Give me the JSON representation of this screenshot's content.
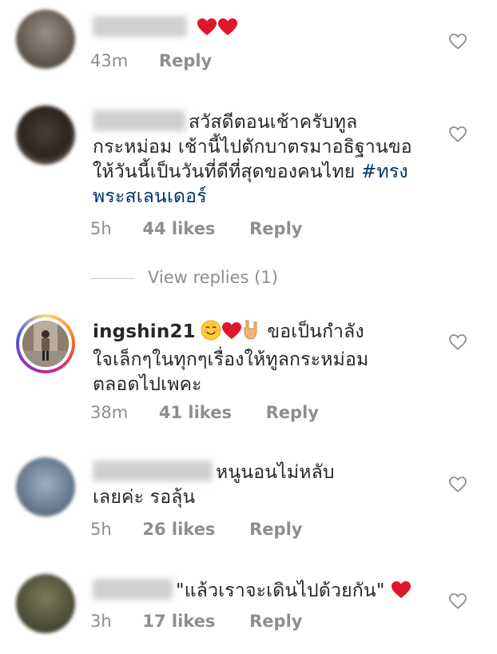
{
  "comments": [
    {
      "username": "",
      "text": "",
      "emojis": [
        "heart",
        "heart"
      ],
      "time": "43m",
      "likes": "",
      "reply": "Reply"
    },
    {
      "username": "",
      "lines": [
        "สวัสดีตอนเช้าครับทูล",
        "กระหม่อม เช้านี้ไปตักบาตรมาอธิฐานขอ",
        "ให้วันนี้เป็นวันที่ดีที่สุดของคนไทย "
      ],
      "hashtag_part1": "#ทรง",
      "hashtag_part2": "พระสเลนเดอร์",
      "time": "5h",
      "likes": "44 likes",
      "reply": "Reply"
    },
    {
      "username": "ingshin21",
      "line1": "ขอเป็นกำลัง",
      "line2": "ใจเล็กๆในทุกๆเรื่องให้ทูลกระหม่อม",
      "line3": "ตลอดไปเพคะ",
      "emojis": [
        "smile",
        "heart",
        "rock-hand"
      ],
      "time": "38m",
      "likes": "41 likes",
      "reply": "Reply"
    },
    {
      "username": "",
      "line1": "หนูนอนไม่หลับ",
      "line2": "เลยค่ะ รอลุ้น",
      "time": "5h",
      "likes": "26 likes",
      "reply": "Reply"
    },
    {
      "username": "",
      "text": "\"แล้วเราจะเดินไปด้วยกัน\"",
      "emojis": [
        "heart"
      ],
      "time": "3h",
      "likes": "17 likes",
      "reply": "Reply"
    }
  ],
  "view_replies": "View replies (1)",
  "icons": {
    "like": "heart-outline-icon",
    "emoji_heart": "red-heart-emoji"
  },
  "colors": {
    "text": "#262626",
    "meta": "#8e8e8e",
    "hashtag": "#003569",
    "heart": "#e0162b"
  }
}
